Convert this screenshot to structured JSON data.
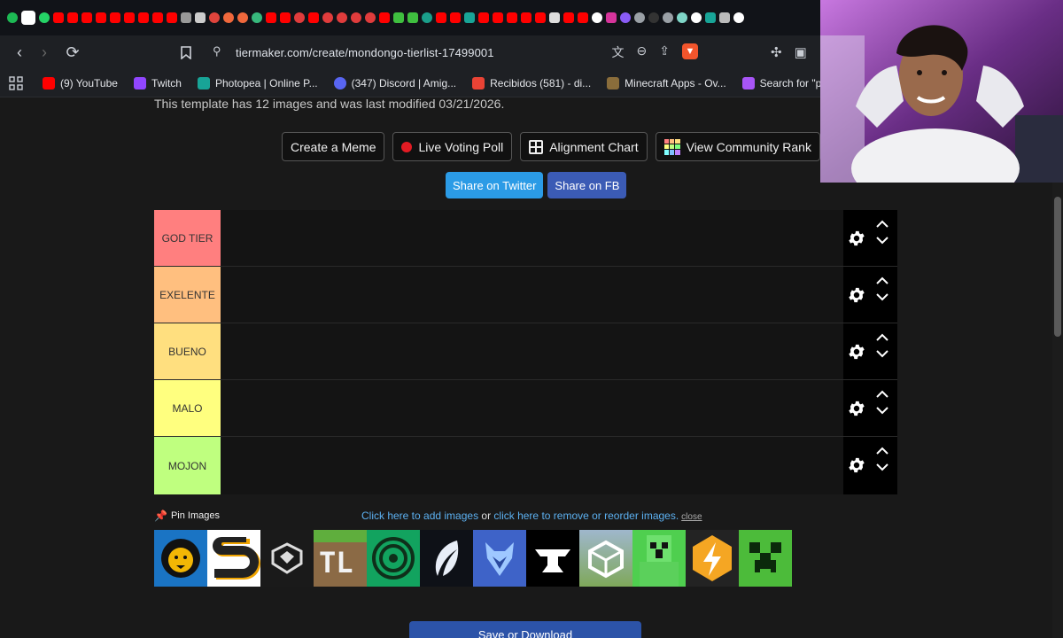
{
  "browser": {
    "url": "tiermaker.com/create/mondongo-tierlist-17499001",
    "bookmarks": [
      {
        "label": "(9) YouTube",
        "color": "#ff0000"
      },
      {
        "label": "Twitch",
        "color": "#9146ff"
      },
      {
        "label": "Photopea | Online P...",
        "color": "#18a497"
      },
      {
        "label": "(347) Discord | Amig...",
        "color": "#5865f2"
      },
      {
        "label": "Recibidos (581) - di...",
        "color": "#ea4335"
      },
      {
        "label": "Minecraft Apps - Ov...",
        "color": "#8a6d3b"
      },
      {
        "label": "Search for \"pc\" foun...",
        "color": "#a855f7"
      }
    ]
  },
  "page": {
    "template_note": "This template has 12 images and was last modified 03/21/2026.",
    "buttons": {
      "create_meme": "Create a Meme",
      "live_poll": "Live Voting Poll",
      "alignment": "Alignment Chart",
      "community_rank": "View Community Rank"
    },
    "share": {
      "twitter": "Share on Twitter",
      "fb": "Share on FB"
    },
    "tiers": [
      {
        "label": "GOD TIER",
        "color": "#ff7f7f"
      },
      {
        "label": "EXELENTE",
        "color": "#ffbf7f"
      },
      {
        "label": "BUENO",
        "color": "#ffdf7f"
      },
      {
        "label": "MALO",
        "color": "#ffff7f"
      },
      {
        "label": "MOJON",
        "color": "#bfff7f"
      }
    ],
    "pin_images": "Pin Images",
    "add_images_link": "Click here to add images",
    "or_text": " or ",
    "reorder_link": "click here to remove or reorder images.",
    "close_link": "close",
    "save": "Save or Download"
  }
}
